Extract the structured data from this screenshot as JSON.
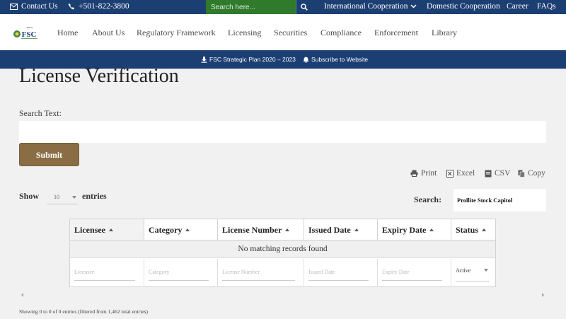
{
  "topbar": {
    "contact_label": "Contact Us",
    "phone": "+501-822-3800",
    "search_placeholder": "Search here...",
    "intl_label": "International Cooperation",
    "domestic_label": "Domestic Cooperation",
    "career_label": "Career",
    "faq_label": "FAQs"
  },
  "logo": {
    "small": "Belize",
    "main": "FSC"
  },
  "nav": {
    "items": [
      "Home",
      "About Us",
      "Regulatory Framework",
      "Licensing",
      "Securities",
      "Compliance",
      "Enforcement",
      "Library"
    ]
  },
  "bluebar": {
    "plan_label": "FSC Strategic Plan 2020 – 2023",
    "subscribe_label": "Subscribe to Website"
  },
  "page": {
    "title": "License Verification",
    "search_text_label": "Search Text:",
    "submit_label": "Submit"
  },
  "tools": {
    "print": "Print",
    "excel": "Excel",
    "csv": "CSV",
    "copy": "Copy"
  },
  "table_controls": {
    "show_label": "Show",
    "page_length": "10",
    "entries_label": "entries",
    "search_label": "Search:",
    "search_value": "Prollite Stock Capitol"
  },
  "table": {
    "headers": [
      "Licensee",
      "Category",
      "License Number",
      "Issued Date",
      "Expiry Date",
      "Status"
    ],
    "empty_message": "No matching records found",
    "filters": [
      "Licensee",
      "Category",
      "License Number",
      "Issued Date",
      "Expiry Date"
    ],
    "status_filter": "Active"
  },
  "info": "Showing 0 to 0 of 0 entries (filtered from 1,462 total entries)",
  "colors": {
    "navy": "#1c3f73",
    "green": "#2f7a2b",
    "gold": "#8b6d45"
  }
}
